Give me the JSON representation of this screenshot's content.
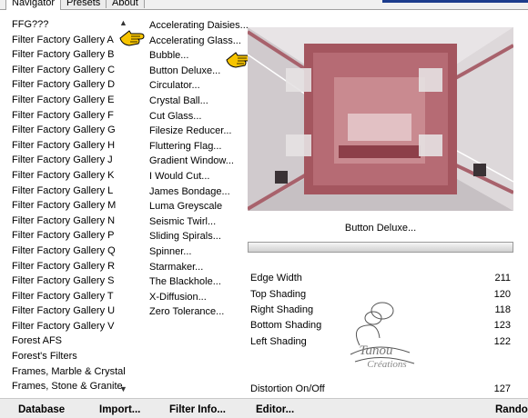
{
  "tabs": [
    "Navigator",
    "Presets",
    "About"
  ],
  "filters": [
    "FFG???",
    "Filter Factory Gallery A",
    "Filter Factory Gallery B",
    "Filter Factory Gallery C",
    "Filter Factory Gallery D",
    "Filter Factory Gallery E",
    "Filter Factory Gallery F",
    "Filter Factory Gallery G",
    "Filter Factory Gallery H",
    "Filter Factory Gallery J",
    "Filter Factory Gallery K",
    "Filter Factory Gallery L",
    "Filter Factory Gallery M",
    "Filter Factory Gallery N",
    "Filter Factory Gallery P",
    "Filter Factory Gallery Q",
    "Filter Factory Gallery R",
    "Filter Factory Gallery S",
    "Filter Factory Gallery T",
    "Filter Factory Gallery U",
    "Filter Factory Gallery V",
    "Forest AFS",
    "Forest's Filters",
    "Frames, Marble & Crystal",
    "Frames, Stone & Granite"
  ],
  "effects": [
    "Accelerating Daisies...",
    "Accelerating Glass...",
    "Bubble...",
    "Button Deluxe...",
    "Circulator...",
    "Crystal Ball...",
    "Cut Glass...",
    "Filesize Reducer...",
    "Fluttering Flag...",
    "Gradient Window...",
    "I Would Cut...",
    "James Bondage...",
    "Luma Greyscale",
    "Seismic Twirl...",
    "Sliding Spirals...",
    "Spinner...",
    "Starmaker...",
    "The Blackhole...",
    "X-Diffusion...",
    "Zero Tolerance..."
  ],
  "selected_filter": "Filter Factory Gallery B",
  "selected_effect": "Button Deluxe...",
  "control_name": "Button Deluxe...",
  "params": [
    {
      "label": "Edge Width",
      "value": "211"
    },
    {
      "label": "Top Shading",
      "value": "120"
    },
    {
      "label": "Right Shading",
      "value": "118"
    },
    {
      "label": "Bottom Shading",
      "value": "123"
    },
    {
      "label": "Left Shading",
      "value": "122"
    },
    {
      "label": "Distortion On/Off",
      "value": "127"
    }
  ],
  "watermark": "Tanou Créations",
  "bottom_buttons": [
    "Database",
    "Import...",
    "Filter Info...",
    "Editor...",
    "Rando"
  ],
  "icons": {
    "scroll_up": "▲",
    "scroll_down": "▼"
  }
}
